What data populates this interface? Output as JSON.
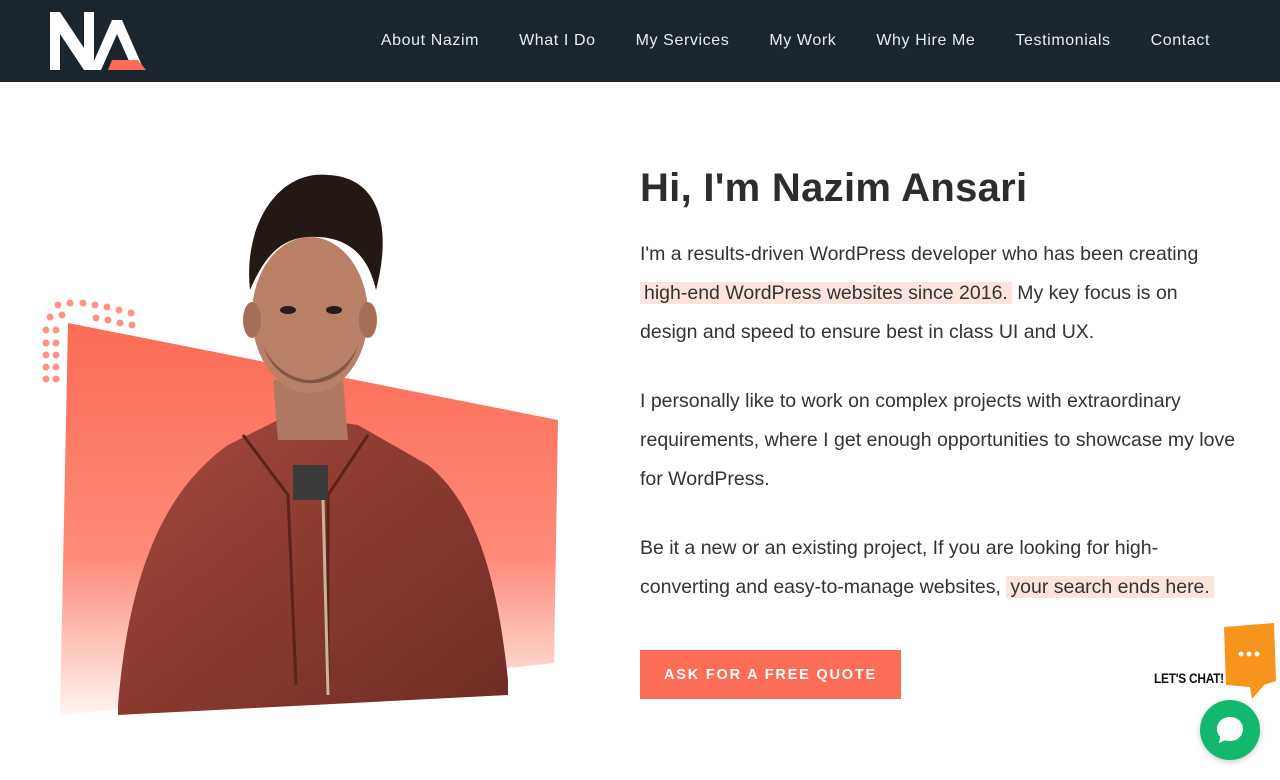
{
  "brand": {
    "logo_text": "NA",
    "accent_color": "#fc6c56",
    "header_bg": "#1a252d"
  },
  "nav": {
    "items": [
      {
        "label": "About Nazim"
      },
      {
        "label": "What I Do"
      },
      {
        "label": "My Services"
      },
      {
        "label": "My Work"
      },
      {
        "label": "Why Hire Me"
      },
      {
        "label": "Testimonials"
      },
      {
        "label": "Contact"
      }
    ]
  },
  "hero": {
    "title": "Hi, I'm Nazim Ansari",
    "p1_before": "I'm a results-driven WordPress developer who has been creating ",
    "p1_highlight": "high-end WordPress websites since 2016.",
    "p1_after": " My key focus is on design and speed to ensure best in class UI and UX.",
    "p2": "I personally like to work on complex projects with extraordinary requirements, where I get enough opportunities to showcase my love for WordPress.",
    "p3_before": "Be it a new or an existing project, If you are looking for high-converting and easy-to-manage websites, ",
    "p3_highlight": "your search ends here.",
    "cta_label": "ASK FOR A FREE QUOTE",
    "portrait_icon": "person-portrait"
  },
  "chat": {
    "lets_chat_label": "LET'S CHAT!",
    "bubble_icon": "ellipsis-speech-bubble-icon",
    "fab_icon": "chat-icon",
    "bubble_color": "#f7941d",
    "fab_color": "#13b86f"
  }
}
